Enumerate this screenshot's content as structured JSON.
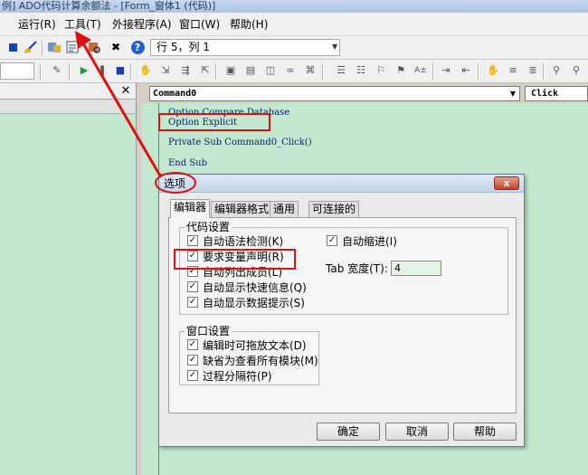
{
  "window": {
    "title": "例] ADO代码计算余额法 - [Form_窗体1 (代码)]"
  },
  "menu": {
    "items": [
      "运行(R)",
      "工具(T)",
      "外接程序(A)",
      "窗口(W)",
      "帮助(H)"
    ]
  },
  "toolbar": {
    "position": "行 5，列 1"
  },
  "code_window": {
    "object_combo": "Command0",
    "procedure_combo": "Click",
    "lines": [
      "Option Compare Database",
      "Option Explicit",
      "Private Sub Command0_Click()",
      "End Sub"
    ]
  },
  "dialog": {
    "title": "选项",
    "close": "x",
    "tabs": [
      "编辑器",
      "编辑器格式",
      "通用",
      "可连接的"
    ],
    "code_settings": {
      "title": "代码设置",
      "options": [
        {
          "label": "自动语法检测(K)",
          "checked": true
        },
        {
          "label": "要求变量声明(R)",
          "checked": true
        },
        {
          "label": "自动列出成员(L)",
          "checked": true
        },
        {
          "label": "自动显示快速信息(Q)",
          "checked": true
        },
        {
          "label": "自动显示数据提示(S)",
          "checked": true
        }
      ],
      "auto_indent": {
        "label": "自动缩进(I)",
        "checked": true
      },
      "tab_width_label": "Tab 宽度(T):",
      "tab_width_value": "4"
    },
    "window_settings": {
      "title": "窗口设置",
      "options": [
        {
          "label": "编辑时可拖放文本(D)",
          "checked": true
        },
        {
          "label": "缺省为查看所有模块(M)",
          "checked": true
        },
        {
          "label": "过程分隔符(P)",
          "checked": true
        }
      ]
    },
    "buttons": {
      "ok": "确定",
      "cancel": "取消",
      "help": "帮助"
    }
  },
  "annotation_color": "#e01010",
  "code_background": "#c2e8cf"
}
